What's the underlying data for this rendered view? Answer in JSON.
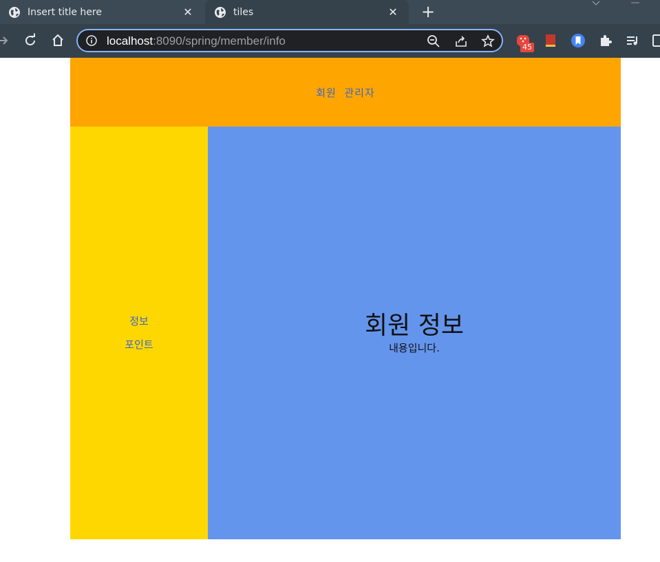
{
  "browser": {
    "tabs": [
      {
        "title": "Insert title here",
        "active": false
      },
      {
        "title": "tiles",
        "active": true
      }
    ],
    "address": {
      "host": "localhost",
      "path": ":8090/spring/member/info"
    },
    "extension_badge": "45"
  },
  "page": {
    "header": {
      "title": "회원  관리자"
    },
    "sidebar": {
      "items": [
        {
          "label": "정보"
        },
        {
          "label": "포인트"
        }
      ]
    },
    "content": {
      "title": "회원 정보",
      "text": "내용입니다."
    }
  },
  "colors": {
    "header_bg": "#ffa500",
    "sidebar_bg": "#ffd700",
    "content_bg": "#6495ed",
    "link": "#3f66c7"
  }
}
